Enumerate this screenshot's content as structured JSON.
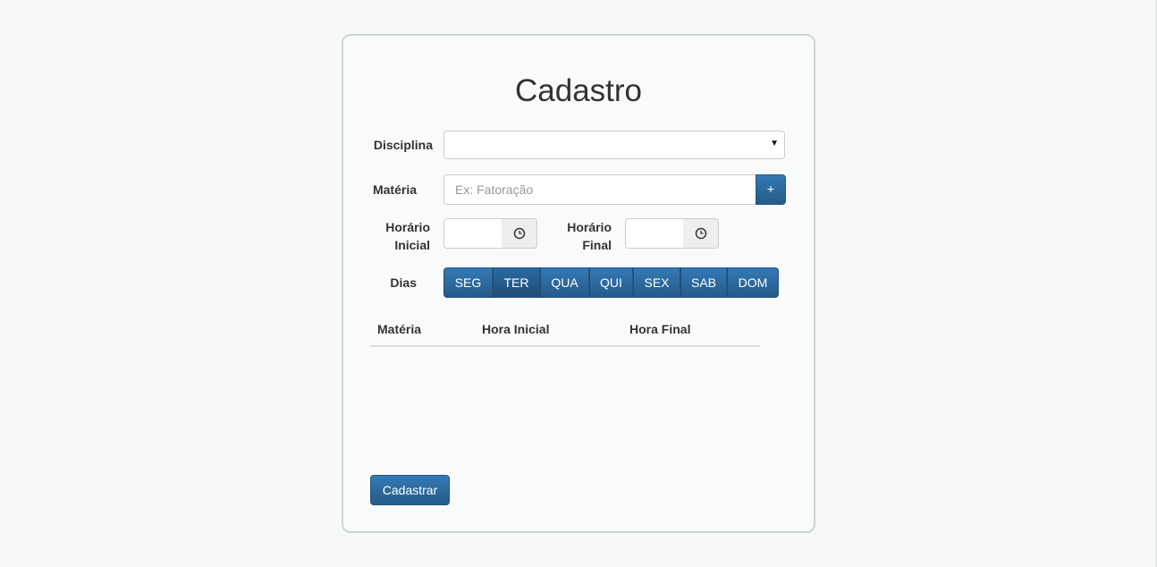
{
  "form": {
    "title": "Cadastro",
    "disciplina_label": "Disciplina",
    "disciplina_value": "",
    "materia_label": "Matéria",
    "materia_placeholder": "Ex: Fatoração",
    "add_materia_label": "+",
    "horario_inicial_label_line1": "Horário",
    "horario_inicial_label_line2": "Inicial",
    "horario_final_label_line1": "Horário",
    "horario_final_label_line2": "Final",
    "dias_label": "Dias",
    "days": [
      "SEG",
      "TER",
      "QUA",
      "QUI",
      "SEX",
      "SAB",
      "DOM"
    ],
    "submit_label": "Cadastrar"
  },
  "table": {
    "columns": [
      "Matéria",
      "Hora Inicial",
      "Hora Final"
    ],
    "rows": []
  },
  "icons": {
    "time_addon": "clock-icon",
    "select_caret": "caret-down-icon"
  },
  "colors": {
    "primary": "#337ab7",
    "primary_dark": "#265a88",
    "background": "#f7f9f9",
    "card_border": "#cfd3d3"
  }
}
